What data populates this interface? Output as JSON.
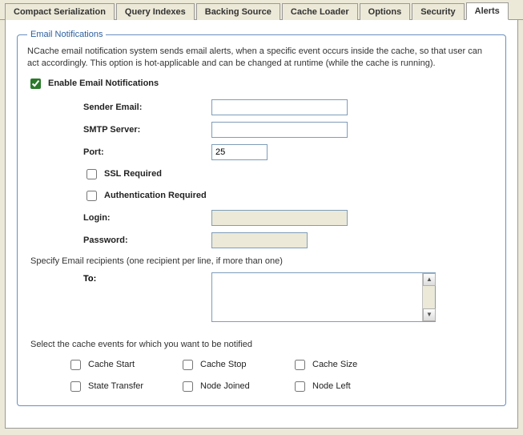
{
  "tabs": [
    {
      "label": "Compact Serialization"
    },
    {
      "label": "Query Indexes"
    },
    {
      "label": "Backing Source"
    },
    {
      "label": "Cache Loader"
    },
    {
      "label": "Options"
    },
    {
      "label": "Security"
    },
    {
      "label": "Alerts"
    }
  ],
  "fieldset_title": "Email Notifications",
  "description": "NCache email notification system sends email alerts, when a specific event occurs inside the cache, so that user can act accordingly. This option is hot-applicable and can be changed at runtime (while the cache is running).",
  "enable_label": "Enable Email Notifications",
  "enable_checked": true,
  "fields": {
    "sender_label": "Sender Email:",
    "sender_value": "",
    "smtp_label": "SMTP Server:",
    "smtp_value": "",
    "port_label": "Port:",
    "port_value": "25",
    "ssl_label": "SSL Required",
    "ssl_checked": false,
    "auth_label": "Authentication Required",
    "auth_checked": false,
    "login_label": "Login:",
    "login_value": "",
    "password_label": "Password:",
    "password_value": ""
  },
  "recipients_note": "Specify Email recipients (one recipient per line, if more than one)",
  "to_label": "To:",
  "to_value": "",
  "events_note": "Select the cache events for which you want to be notified",
  "events": [
    {
      "label": "Cache Start",
      "checked": false
    },
    {
      "label": "Cache Stop",
      "checked": false
    },
    {
      "label": "Cache Size",
      "checked": false
    },
    {
      "label": "State Transfer",
      "checked": false
    },
    {
      "label": "Node Joined",
      "checked": false
    },
    {
      "label": "Node Left",
      "checked": false
    }
  ]
}
